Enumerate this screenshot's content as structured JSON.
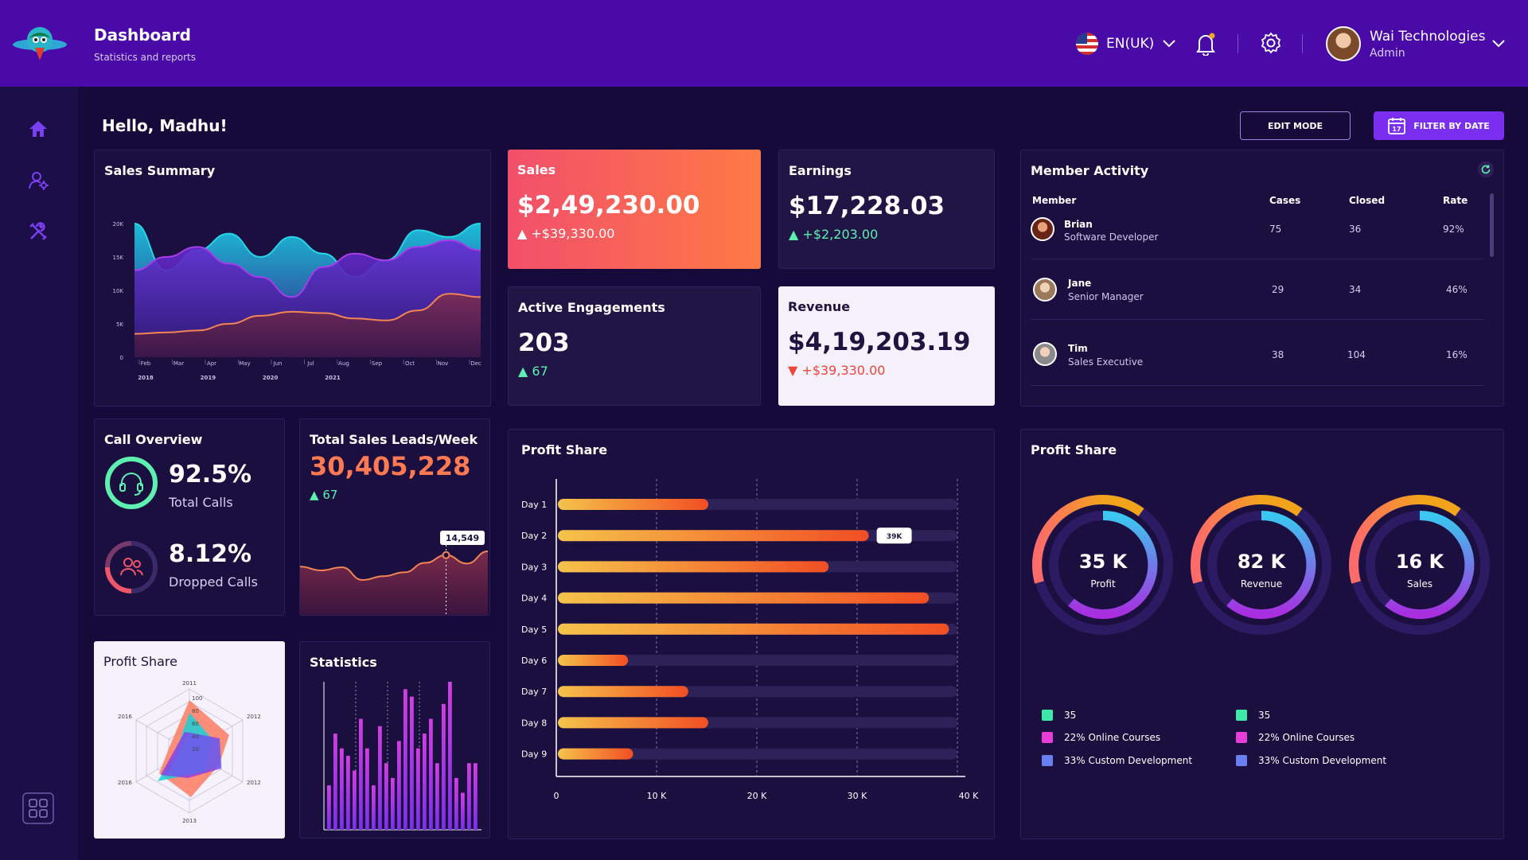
{
  "header": {
    "title": "Dashboard",
    "subtitle": "Statistics and reports",
    "language": "EN(UK)",
    "user_name": "Wai Technologies",
    "user_role": "Admin"
  },
  "sidebar": {
    "items": [
      "home-icon",
      "user-settings-icon",
      "tools-icon",
      "apps-grid-icon"
    ]
  },
  "greeting": "Hello, Madhu!",
  "actions": {
    "edit_mode": "EDIT MODE",
    "filter_by_date": "FILTER BY DATE",
    "calendar_day": "17"
  },
  "sales_summary": {
    "title": "Sales Summary",
    "chart_data": {
      "type": "area",
      "y_ticks": [
        "20K",
        "15K",
        "10K",
        "5K",
        "0"
      ],
      "ylim": [
        0,
        20000
      ],
      "month_labels": [
        "Feb",
        "Mar",
        "Apr",
        "May",
        "Jun",
        "Jul",
        "Aug",
        "Sep",
        "Oct",
        "Nov",
        "Dec"
      ],
      "year_labels": [
        "2018",
        "2019",
        "2020",
        "2021"
      ],
      "series": [
        {
          "values": [
            20000,
            13000,
            16000,
            18500,
            15000,
            18000,
            15500,
            12000,
            14500,
            19000,
            18000,
            20000
          ],
          "color": "#27d3e6"
        },
        {
          "values": [
            13000,
            15000,
            16500,
            14000,
            12000,
            9000,
            13500,
            15500,
            14500,
            16500,
            17500,
            16000
          ],
          "color": "#a33ee8"
        },
        {
          "values": [
            3500,
            3700,
            4000,
            5000,
            6200,
            6800,
            6600,
            5800,
            5500,
            7000,
            9500,
            9000
          ],
          "color": "#f28455"
        }
      ]
    }
  },
  "sales": {
    "title": "Sales",
    "value": "$2,49,230.00",
    "delta": "+$39,330.00"
  },
  "earnings": {
    "title": "Earnings",
    "value": "$17,228.03",
    "delta": "+$2,203.00"
  },
  "engagements": {
    "title": "Active Engagements",
    "value": "203",
    "delta": "67"
  },
  "revenue": {
    "title": "Revenue",
    "value": "$4,19,203.19",
    "delta": "+$39,330.00"
  },
  "member_activity": {
    "title": "Member Activity",
    "columns": [
      "Member",
      "Cases",
      "Closed",
      "Rate"
    ],
    "rows": [
      {
        "name": "Brian",
        "role": "Software Developer",
        "cases": "75",
        "closed": "36",
        "rate": "92%"
      },
      {
        "name": "Jane",
        "role": "Senior Manager",
        "cases": "29",
        "closed": "34",
        "rate": "46%"
      },
      {
        "name": "Tim",
        "role": "Sales Executive",
        "cases": "38",
        "closed": "104",
        "rate": "16%"
      }
    ]
  },
  "call_overview": {
    "title": "Call Overview",
    "total_calls_value": "92.5%",
    "total_calls_label": "Total Calls",
    "dropped_calls_value": "8.12%",
    "dropped_calls_label": "Dropped Calls"
  },
  "leads": {
    "title": "Total Sales Leads/Week",
    "value": "30,405,228",
    "delta": "67",
    "tooltip": "14,549",
    "chart_data": {
      "type": "area",
      "values": [
        60,
        50,
        58,
        25,
        35,
        45,
        70,
        90,
        68,
        100
      ]
    }
  },
  "profit_share_bars": {
    "title": "Profit Share",
    "tooltip": "39K",
    "chart_data": {
      "type": "bar",
      "orientation": "horizontal",
      "categories": [
        "Day 1",
        "Day 2",
        "Day 3",
        "Day 4",
        "Day 5",
        "Day 6",
        "Day 7",
        "Day 8",
        "Day 9"
      ],
      "values": [
        15000,
        31000,
        27000,
        37000,
        39000,
        7000,
        13000,
        15000,
        7500
      ],
      "max": 40000,
      "x_ticks": [
        "0",
        "10 K",
        "20 K",
        "30 K",
        "40 K"
      ]
    }
  },
  "profit_share_donuts": {
    "title": "Profit Share",
    "donuts": [
      {
        "value": "35 K",
        "label": "Profit"
      },
      {
        "value": "82 K",
        "label": "Revenue"
      },
      {
        "value": "16 K",
        "label": "Sales"
      }
    ],
    "legend_left": [
      {
        "label": "35",
        "color": "#3ee8a8"
      },
      {
        "label": "22% Online Courses",
        "color": "#e83ed8"
      },
      {
        "label": "33% Custom Development",
        "color": "#6a7ff0"
      }
    ],
    "legend_right": [
      {
        "label": "35",
        "color": "#3ee8a8"
      },
      {
        "label": "22% Online Courses",
        "color": "#e83ed8"
      },
      {
        "label": "33% Custom Development",
        "color": "#6a7ff0"
      }
    ]
  },
  "profit_share_radar": {
    "title": "Profit Share",
    "axis_labels": [
      "2011",
      "2012",
      "2012",
      "2013",
      "2016",
      "2016"
    ],
    "scale_labels": [
      "100",
      "80",
      "60",
      "40",
      "20"
    ]
  },
  "statistics": {
    "title": "Statistics",
    "chart_data": {
      "type": "bar",
      "values": [
        30,
        65,
        55,
        50,
        40,
        75,
        55,
        30,
        70,
        45,
        35,
        60,
        95,
        90,
        55,
        65,
        75,
        45,
        85,
        100,
        35,
        25,
        45,
        45
      ]
    }
  }
}
